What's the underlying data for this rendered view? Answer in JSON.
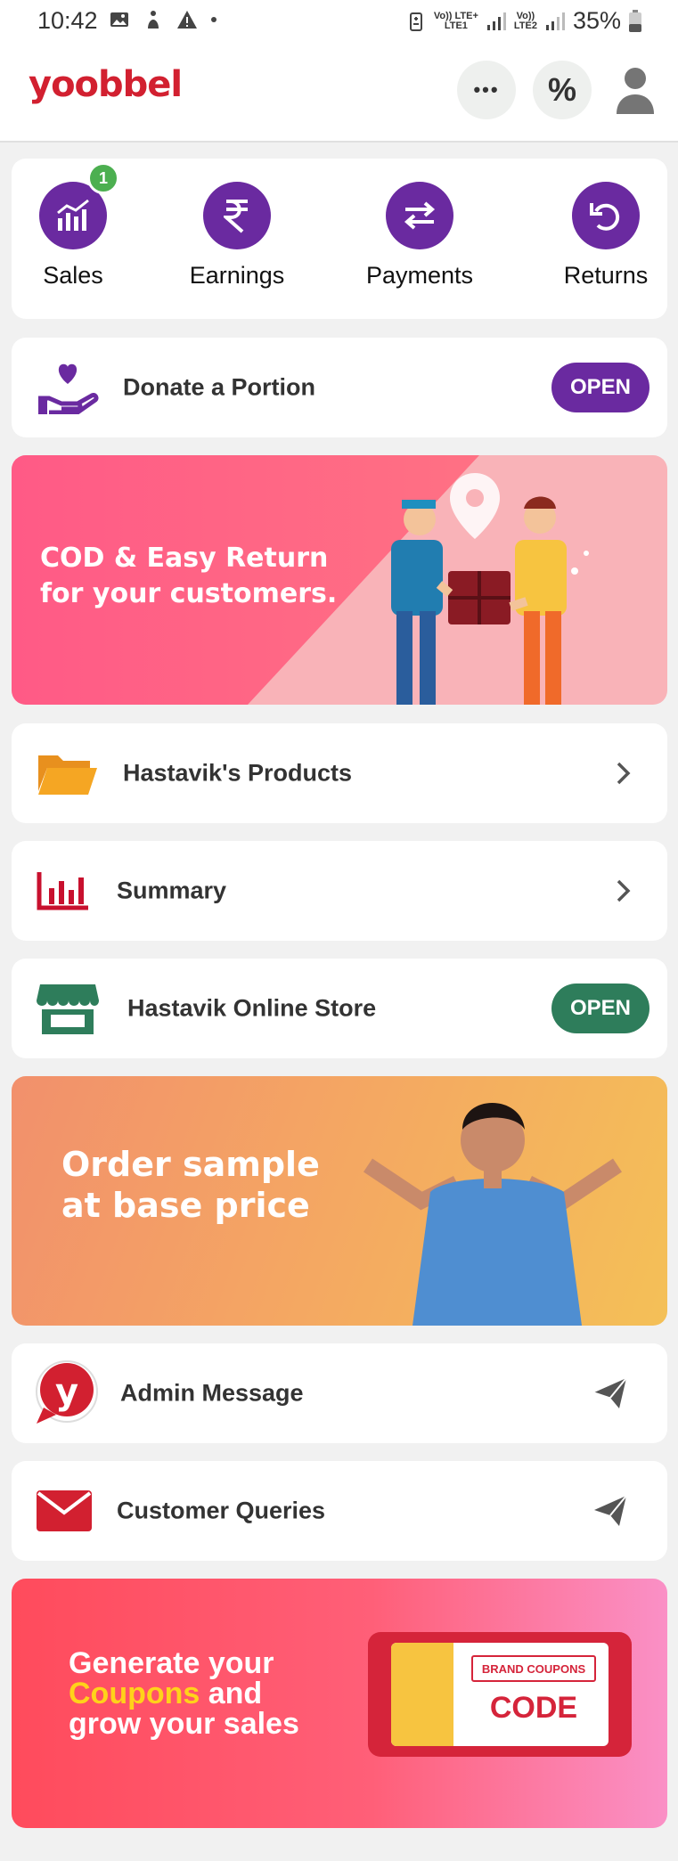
{
  "status_bar": {
    "time": "10:42",
    "net1": "Vo)) LTE+",
    "net1_sub": "LTE1",
    "net2": "Vo))",
    "net2_sub": "LTE2",
    "battery": "35%"
  },
  "app_bar": {
    "logo": "yoobbel",
    "more_label": "•••",
    "percent_label": "%"
  },
  "quick_actions": [
    {
      "label": "Sales",
      "badge": "1",
      "icon": "sales-chart-icon"
    },
    {
      "label": "Earnings",
      "icon": "rupee-icon"
    },
    {
      "label": "Payments",
      "icon": "swap-arrows-icon"
    },
    {
      "label": "Returns",
      "icon": "undo-icon"
    }
  ],
  "donate": {
    "label": "Donate a Portion",
    "button": "OPEN"
  },
  "cod_banner": {
    "line1": "COD & Easy Return",
    "line2": "for your customers."
  },
  "products": {
    "label": "Hastavik's Products"
  },
  "summary": {
    "label": "Summary"
  },
  "store": {
    "label": "Hastavik Online Store",
    "button": "OPEN"
  },
  "sample_banner": {
    "line1": "Order sample",
    "line2": "at base price"
  },
  "admin": {
    "label": "Admin Message",
    "logo_letter": "y"
  },
  "queries": {
    "label": "Customer Queries"
  },
  "coupons_banner": {
    "line1": "Generate your",
    "line2_highlight": "Coupons",
    "line2_rest": " and",
    "line3": "grow your sales",
    "ticket_top": "BRAND COUPONS",
    "ticket_code": "CODE"
  },
  "colors": {
    "brand_red": "#d22030",
    "purple": "#6a2aa0",
    "green": "#2e7d5b",
    "orange": "#f5a623"
  }
}
